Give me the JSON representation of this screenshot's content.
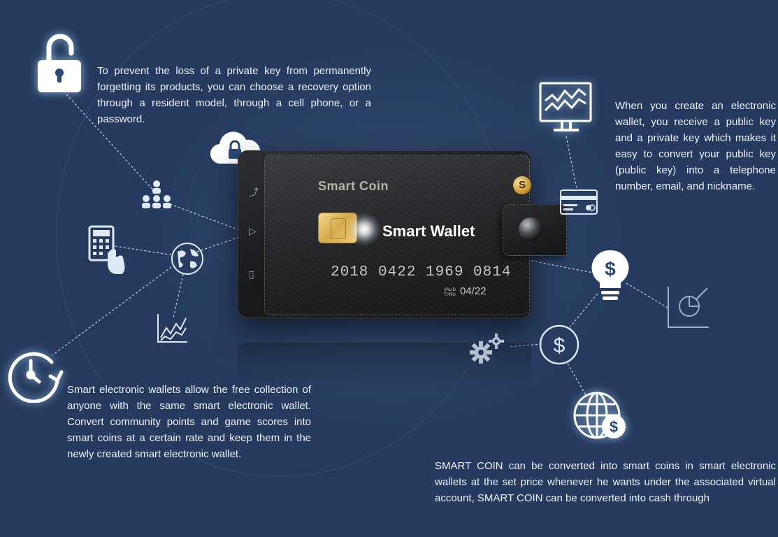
{
  "texts": {
    "recovery": "To prevent the loss of a private key from permanently forgetting its products, you can choose a recovery option through a resident model, through a cell phone, or a password.",
    "keys": "When you create an electronic wallet, you receive a public key and a private key which makes it easy to convert your public key (public key) into a telephone number, email, and nickname.",
    "collection": "Smart electronic wallets allow the free collection of anyone with the same smart electronic wallet. Convert community points and game scores into smart coins at a certain rate and keep them in the newly created smart electronic wallet.",
    "conversion": "SMART COIN can be converted into smart coins in smart electronic wallets at the set price whenever he wants under the associated virtual account, SMART COIN can be converted into cash through"
  },
  "card": {
    "brand": "Smart Coin",
    "logo_letter": "S",
    "title": "Smart Wallet",
    "number": "2018 0422 1969 0814",
    "valid_label_1": "VALID",
    "valid_label_2": "THRU",
    "expiry": "04/22"
  },
  "icons": {
    "dollar_symbol": "$"
  },
  "colors": {
    "background": "#253a5e",
    "icon_stroke": "#dfe8f5",
    "glow": "#aad7ff",
    "chip_gold": "#d4aa4e"
  }
}
